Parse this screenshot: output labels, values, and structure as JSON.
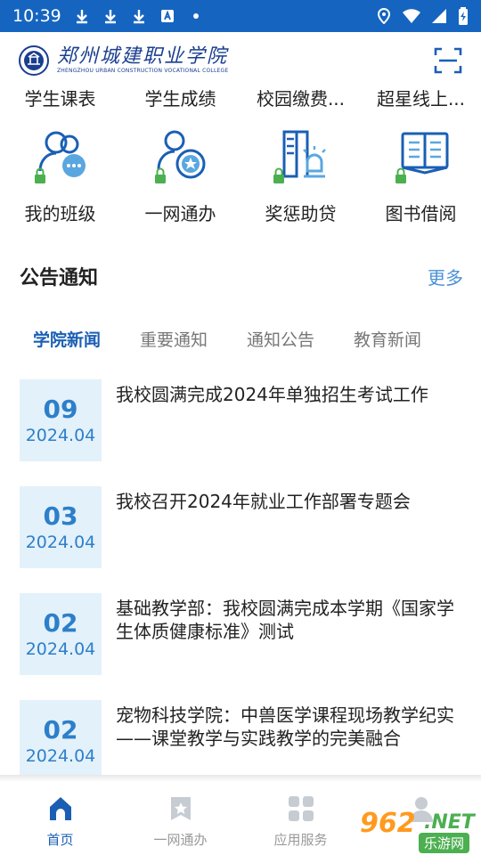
{
  "status_bar": {
    "time": "10:39",
    "left_icons": [
      "download-icon",
      "download-icon",
      "download-icon",
      "app-store-icon",
      "dot-icon"
    ],
    "right_icons": [
      "location-icon",
      "wifi-icon",
      "signal-icon",
      "battery-icon"
    ]
  },
  "header": {
    "logo_name": "郑州城建职业学院",
    "logo_subtitle": "ZHENGZHOU URBAN CONSTRUCTION VOCATIONAL COLLEGE",
    "scan_icon": "scan-icon"
  },
  "quick_top": [
    {
      "label": "学生课表"
    },
    {
      "label": "学生成绩"
    },
    {
      "label": "校园缴费..."
    },
    {
      "label": "超星线上..."
    }
  ],
  "quick_grid": [
    {
      "label": "我的班级",
      "icon": "class-icon"
    },
    {
      "label": "一网通办",
      "icon": "service-icon"
    },
    {
      "label": "奖惩助贷",
      "icon": "award-icon"
    },
    {
      "label": "图书借阅",
      "icon": "book-icon"
    }
  ],
  "notice": {
    "title": "公告通知",
    "more": "更多"
  },
  "tabs": [
    {
      "label": "学院新闻",
      "active": true
    },
    {
      "label": "重要通知",
      "active": false
    },
    {
      "label": "通知公告",
      "active": false
    },
    {
      "label": "教育新闻",
      "active": false
    }
  ],
  "news": [
    {
      "day": "09",
      "ym": "2024.04",
      "title": "我校圆满完成2024年单独招生考试工作"
    },
    {
      "day": "03",
      "ym": "2024.04",
      "title": "我校召开2024年就业工作部署专题会"
    },
    {
      "day": "02",
      "ym": "2024.04",
      "title": "基础教学部：我校圆满完成本学期《国家学生体质健康标准》测试"
    },
    {
      "day": "02",
      "ym": "2024.04",
      "title": "宠物科技学院：中兽医学课程现场教学纪实——课堂教学与实践教学的完美融合"
    }
  ],
  "bottom_nav": [
    {
      "label": "首页",
      "icon": "home-icon",
      "active": true
    },
    {
      "label": "一网通办",
      "icon": "bookmark-icon",
      "active": false
    },
    {
      "label": "应用服务",
      "icon": "apps-icon",
      "active": false
    },
    {
      "label": "",
      "icon": "profile-icon",
      "active": false
    }
  ],
  "watermark": {
    "number": "962",
    "net": ".NET",
    "sub": "乐游网"
  },
  "colors": {
    "status_bar": "#1565c0",
    "accent": "#1a5fb4",
    "date_bg": "#e3f1fb",
    "lock_green": "#4caf50",
    "more_link": "#4a90d9"
  }
}
